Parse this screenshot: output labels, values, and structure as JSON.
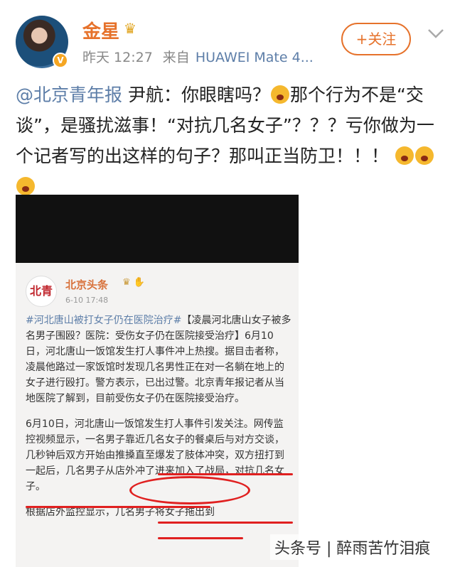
{
  "post": {
    "username": "金星",
    "time": "昨天 12:27",
    "from_label": "来自",
    "device": "HUAWEI Mate 4...",
    "follow_label": "+关注",
    "mention": "@北京青年报",
    "text_main": " 尹航：你眼瞎吗？",
    "text_2": "那个行为不是“交谈”，是骚扰滋事！“对抗几名女子”？？？亏你做为一个记者写的出这样的句子？那叫正当防卫！！！"
  },
  "embedded": {
    "avatar_text": "北青",
    "name": "北京头条",
    "time": "6-10 17:48",
    "hashtag": "#河北唐山被打女子仍在医院治疗#",
    "para1": "【凌晨河北唐山女子被多名男子围殴？医院：受伤女子仍在医院接受治疗】6月10日，河北唐山一饭馆发生打人事件冲上热搜。据目击者称，凌晨他路过一家饭馆时发现几名男性正在对一名躺在地上的女子进行殴打。警方表示，已出过警。北京青年报记者从当地医院了解到，目前受伤女子仍在医院接受治疗。",
    "para2": "6月10日，河北唐山一饭馆发生打人事件引发关注。网传监控视频显示，一名男子靠近几名女子的餐桌后与对方交谈，几秒钟后双方开始由推搡直至爆发了肢体冲突，双方扭打到一起后，几名男子从店外冲了进来加入了战局，对抗几名女子。",
    "para3": "根据店外监控显示，几名男子将女子拖出到"
  },
  "watermark": "头条号 | 醉雨苦竹泪痕",
  "colors": {
    "accent": "#e6722b",
    "link": "#5d7ea8",
    "mark": "#e02020"
  }
}
